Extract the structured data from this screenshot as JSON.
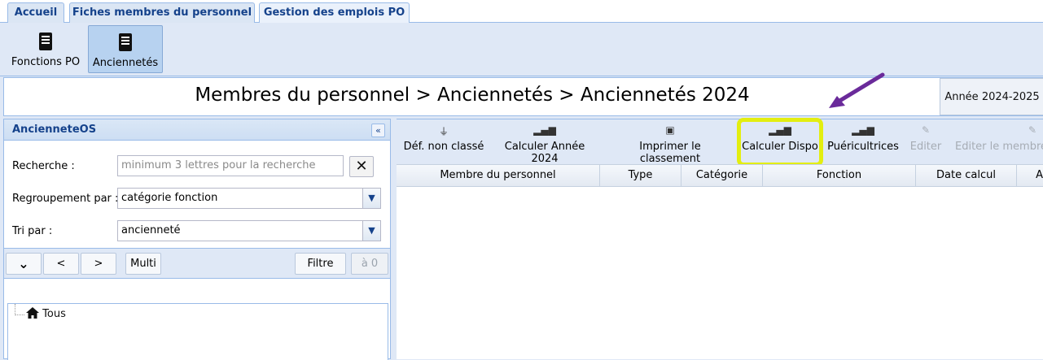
{
  "tabs": [
    {
      "label": "Accueil"
    },
    {
      "label": "Fiches membres du personnel"
    },
    {
      "label": "Gestion des emplois PO"
    }
  ],
  "toolbar": {
    "buttons": [
      {
        "label": "Fonctions PO",
        "icon": "document-icon"
      },
      {
        "label": "Anciennetés",
        "icon": "document-icon"
      }
    ]
  },
  "page": {
    "title": "Membres du personnel > Anciennetés > Anciennetés 2024",
    "year_button": "Année 2024-2025"
  },
  "left_panel": {
    "title": "AncienneteOS",
    "search_label": "Recherche :",
    "search_placeholder": "minimum 3 lettres pour la recherche",
    "group_label": "Regroupement par :",
    "group_value": "catégorie fonction",
    "sort_label": "Tri par :",
    "sort_value": "ancienneté",
    "buttons": {
      "prev": "<",
      "next": ">",
      "multi": "Multi",
      "filter": "Filtre",
      "zero": "à 0"
    },
    "tree_root": "Tous"
  },
  "actions": [
    {
      "label": "Déf. non classé",
      "icon": "filter-icon",
      "enabled": true
    },
    {
      "label": "Calculer Année 2024",
      "icon": "chart-icon",
      "enabled": true
    },
    {
      "label": "Imprimer le classement",
      "icon": "print-icon",
      "enabled": true
    },
    {
      "label": "Calculer Dispo",
      "icon": "chart-icon",
      "enabled": true
    },
    {
      "label": "Puéricultrices",
      "icon": "chart-icon",
      "enabled": true
    },
    {
      "label": "Editer",
      "icon": "edit-icon",
      "enabled": false
    },
    {
      "label": "Editer le membre",
      "icon": "edit-icon",
      "enabled": false
    }
  ],
  "grid": {
    "columns": [
      "Membre du personnel",
      "Type",
      "Catégorie",
      "Fonction",
      "Date calcul",
      "A"
    ]
  },
  "colors": {
    "accent": "#15428b",
    "highlight": "#e3ee10",
    "arrow": "#6a2a9a"
  }
}
